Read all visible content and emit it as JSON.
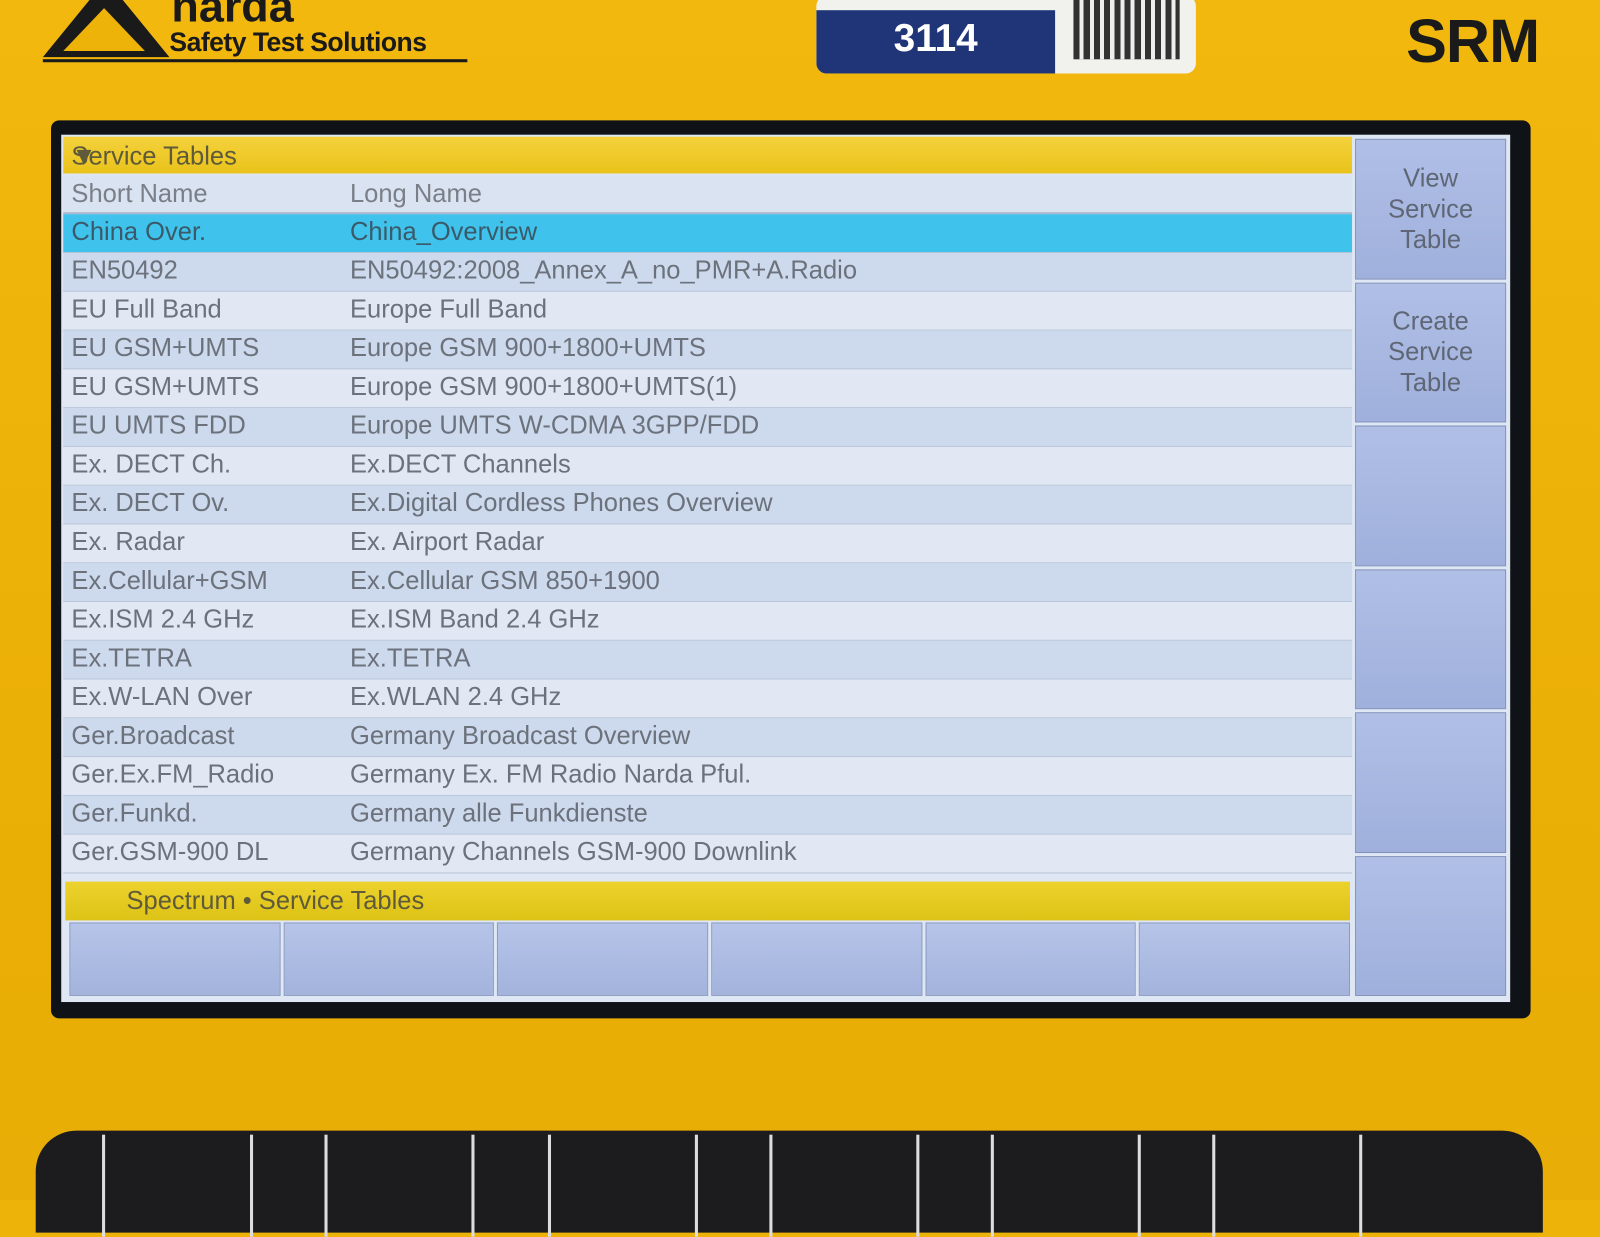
{
  "device": {
    "brand": "narda",
    "tagline": "Safety Test Solutions",
    "serial_label": "3114",
    "model": "SRM",
    "case_color": "#eeb309"
  },
  "screen": {
    "title": "Service Tables",
    "dropdown_icon": "triangle-down",
    "columns": {
      "short": "Short Name",
      "long": "Long Name"
    },
    "selected_index": 0,
    "highlight_color": "#3fc3ec",
    "rows": [
      {
        "short": "China Over.",
        "long": "China_Overview"
      },
      {
        "short": "EN50492",
        "long": "EN50492:2008_Annex_A_no_PMR+A.Radio"
      },
      {
        "short": "EU Full Band",
        "long": "Europe Full Band"
      },
      {
        "short": "EU GSM+UMTS",
        "long": "Europe GSM 900+1800+UMTS"
      },
      {
        "short": "EU GSM+UMTS",
        "long": "Europe GSM 900+1800+UMTS(1)"
      },
      {
        "short": "EU UMTS FDD",
        "long": "Europe UMTS W-CDMA 3GPP/FDD"
      },
      {
        "short": "Ex. DECT Ch.",
        "long": "Ex.DECT Channels"
      },
      {
        "short": "Ex. DECT Ov.",
        "long": "Ex.Digital Cordless Phones Overview"
      },
      {
        "short": "Ex. Radar",
        "long": "Ex. Airport Radar"
      },
      {
        "short": "Ex.Cellular+GSM",
        "long": "Ex.Cellular GSM 850+1900"
      },
      {
        "short": "Ex.ISM 2.4 GHz",
        "long": "Ex.ISM Band 2.4 GHz"
      },
      {
        "short": "Ex.TETRA",
        "long": "Ex.TETRA"
      },
      {
        "short": "Ex.W-LAN Over",
        "long": "Ex.WLAN 2.4 GHz"
      },
      {
        "short": "Ger.Broadcast",
        "long": "Germany Broadcast Overview"
      },
      {
        "short": "Ger.Ex.FM_Radio",
        "long": "Germany Ex. FM Radio Narda Pful."
      },
      {
        "short": "Ger.Funkd.",
        "long": "Germany alle Funkdienste"
      },
      {
        "short": "Ger.GSM-900 DL",
        "long": "Germany Channels GSM-900 Downlink"
      }
    ],
    "status": "Spectrum • Service Tables",
    "side_keys": [
      "View\nService\nTable",
      "Create\nService\nTable",
      "",
      "",
      "",
      ""
    ],
    "bottom_keys": [
      "",
      "",
      "",
      "",
      "",
      ""
    ]
  }
}
